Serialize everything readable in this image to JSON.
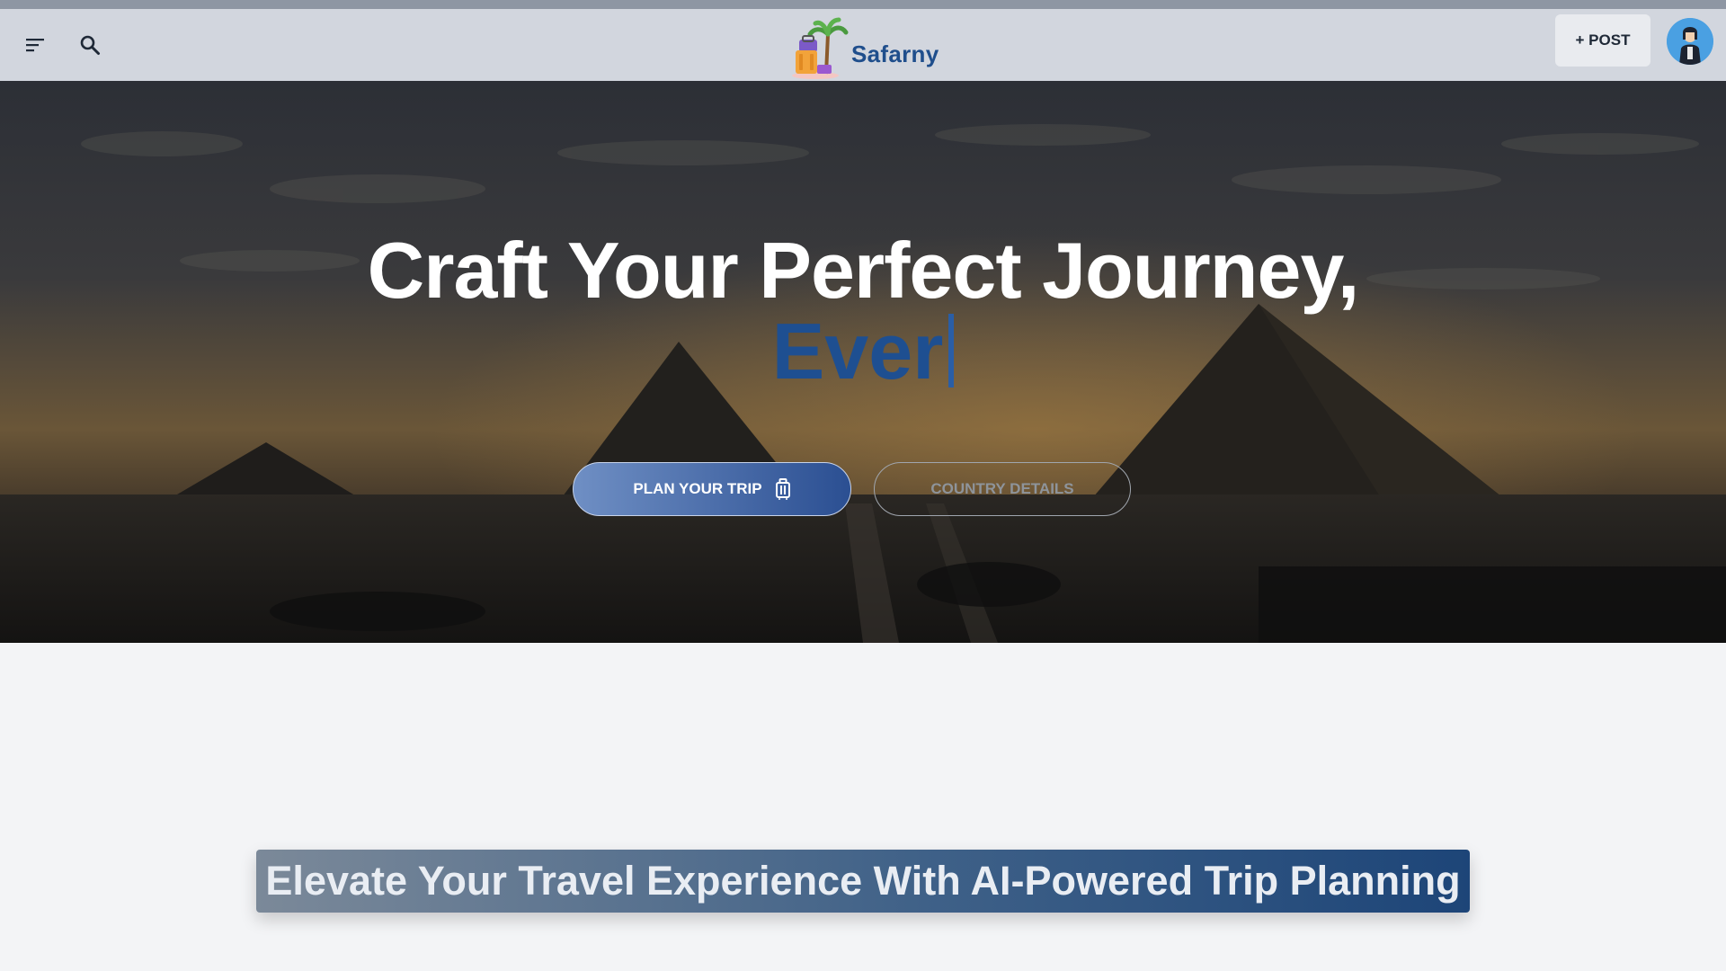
{
  "brand": {
    "name": "Safarny"
  },
  "header": {
    "menu_icon": "hamburger-menu-icon",
    "search_icon": "search-icon",
    "post_label": "+ POST",
    "avatar_icon": "user-avatar-icon"
  },
  "hero": {
    "title": "Craft Your Perfect Journey,",
    "typed_text": "Ever",
    "primary_button": "PLAN YOUR TRIP",
    "primary_button_icon": "luggage-icon",
    "secondary_button": "COUNTRY DETAILS"
  },
  "tagline": "Elevate Your Travel Experience With AI-Powered Trip Planning",
  "colors": {
    "brand_blue": "#1f4e8c",
    "navbar": "#d2d6de",
    "page_background": "#f3f4f6",
    "typed_text": "#1e4f91"
  }
}
